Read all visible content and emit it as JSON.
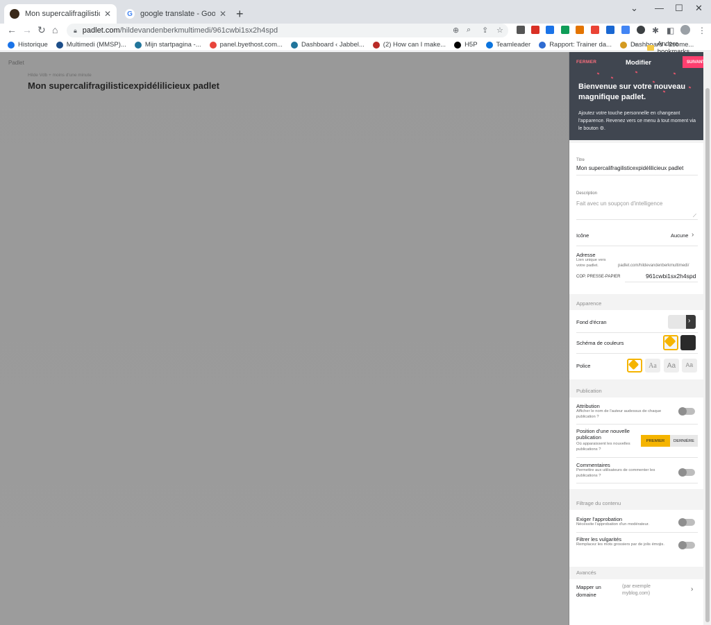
{
  "browser": {
    "tabs": [
      {
        "title": "Mon supercalifragilisticexpidélilic",
        "active": true
      },
      {
        "title": "google translate - Google Zoeke",
        "active": false
      }
    ],
    "new_tab": "+",
    "address": {
      "host": "padlet.com",
      "path": "/hildevandenberkmultimedi/961cwbi1sx2h4spd"
    },
    "bookmarks": [
      {
        "label": "Historique",
        "color": "#1a73e8"
      },
      {
        "label": "Multimedi (MMSP)...",
        "color": "#1d4e89"
      },
      {
        "label": "Mijn startpagina -...",
        "color": "#21759b"
      },
      {
        "label": "panel.byethost.com...",
        "color": "#e8453c"
      },
      {
        "label": "Dashboard ‹ Jabbel...",
        "color": "#21759b"
      },
      {
        "label": "(2) How can I make...",
        "color": "#b92b27"
      },
      {
        "label": "H5P",
        "color": "#000000"
      },
      {
        "label": "Teamleader",
        "color": "#0b74de"
      },
      {
        "label": "Rapport: Trainer da...",
        "color": "#2e6bd1"
      },
      {
        "label": "Dashboard ‹ 2some...",
        "color": "#d49a20"
      }
    ],
    "bookmarks_more": "»",
    "other_bookmarks": "Andere bookmarks"
  },
  "board": {
    "logo": "Padlet",
    "owner": "Hilde Vdb + moins d'une minute",
    "title": "Mon supercalifragilisticexpidélilicieux padlet"
  },
  "panel": {
    "close": "FERMER",
    "header_title": "Modifier",
    "next": "SUIVANT",
    "hero_heading": "Bienvenue sur votre nouveau magnifique padlet.",
    "hero_body": "Ajoutez votre touche personnelle en changeant l'apparence. Revenez vers ce menu à tout moment via le bouton ⚙.",
    "title_label": "Titre",
    "title_value": "Mon supercalifragilisticexpidélilicieux padlet",
    "description_label": "Description",
    "description_placeholder": "Fait avec un soupçon d'intelligence",
    "icon_label": "Icône",
    "icon_value": "Aucune",
    "address_label": "Adresse",
    "address_help": "Lien unique vers votre padlet.",
    "address_prefix": "padlet.com/hildevandenberkmultimedi/",
    "copy_label": "COP. PRESSE-PAPIER",
    "address_slug": "961cwbi1sx2h4spd",
    "appearance_head": "Apparence",
    "wallpaper_label": "Fond d'écran",
    "scheme_label": "Schéma de couleurs",
    "font_label": "Police",
    "font_options": [
      "Aa",
      "Aa",
      "Aa"
    ],
    "publication_head": "Publication",
    "attribution_label": "Attribution",
    "attribution_help": "Afficher le nom de l'auteur audessus de chaque publication ?",
    "position_label": "Position d'une nouvelle publication",
    "position_help": "Où apparaissent les nouvelles publications ?",
    "position_first": "PREMIER",
    "position_last": "DERNIÈRE",
    "comments_label": "Commentaires",
    "comments_help": "Permettre aux utilisateurs de commenter les publications ?",
    "filter_head": "Filtrage du contenu",
    "approval_label": "Exiger l'approbation",
    "approval_help": "Nécessite l'approbation d'un modérateur.",
    "profanity_label": "Filtrer les vulgarités",
    "profanity_help": "Remplacez les mots grossiers par de jolis émojis.",
    "advanced_head": "Avancés",
    "domain_label": "Mapper un domaine",
    "domain_placeholder": "(par exemple myblog.com)"
  },
  "colors": {
    "accent": "#ff3f6f",
    "hero_bg": "#404650",
    "selected": "#f5b400"
  }
}
